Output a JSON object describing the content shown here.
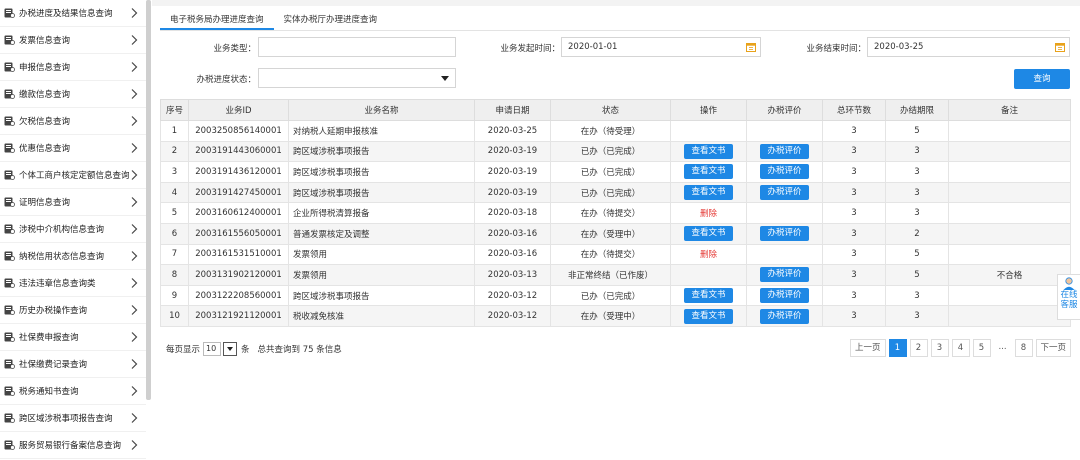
{
  "sidebar": {
    "items": [
      {
        "label": "办税进度及结果信息查询",
        "icon": "progress-search-icon"
      },
      {
        "label": "发票信息查询",
        "icon": "invoice-icon"
      },
      {
        "label": "申报信息查询",
        "icon": "declare-icon"
      },
      {
        "label": "缴款信息查询",
        "icon": "payment-icon"
      },
      {
        "label": "欠税信息查询",
        "icon": "arrears-icon"
      },
      {
        "label": "优惠信息查询",
        "icon": "discount-icon"
      },
      {
        "label": "个体工商户核定定额信息查询",
        "icon": "business-icon"
      },
      {
        "label": "证明信息查询",
        "icon": "certificate-icon"
      },
      {
        "label": "涉税中介机构信息查询",
        "icon": "agency-icon"
      },
      {
        "label": "纳税信用状态信息查询",
        "icon": "credit-icon"
      },
      {
        "label": "违法违章信息查询类",
        "icon": "violation-icon"
      },
      {
        "label": "历史办税操作查询",
        "icon": "history-icon"
      },
      {
        "label": "社保费申报查询",
        "icon": "social-security-icon"
      },
      {
        "label": "社保缴费记录查询",
        "icon": "social-record-icon"
      },
      {
        "label": "税务通知书查询",
        "icon": "notice-icon"
      },
      {
        "label": "跨区域涉税事项报告查询",
        "icon": "cross-region-icon"
      },
      {
        "label": "服务贸易银行备案信息查询",
        "icon": "trade-icon"
      }
    ]
  },
  "tabs": [
    {
      "label": "电子税务局办理进度查询"
    },
    {
      "label": "实体办税厅办理进度查询"
    }
  ],
  "filters": {
    "business_type_label": "业务类型：",
    "business_type_value": "",
    "start_time_label": "业务发起时间：",
    "start_time_value": "2020-01-01",
    "end_time_label": "业务结束时间：",
    "end_time_value": "2020-03-25",
    "status_label": "办税进度状态：",
    "status_value": "",
    "query_button": "查询"
  },
  "table": {
    "headers": [
      "序号",
      "业务ID",
      "业务名称",
      "申请日期",
      "状态",
      "操作",
      "办税评价",
      "总环节数",
      "办结期限",
      "备注"
    ],
    "rows": [
      {
        "no": "1",
        "id": "2003250856140001",
        "name": "对纳税人延期申报核准",
        "date": "2020-03-25",
        "status": "在办（待受理）",
        "status_color": "blue",
        "action": "",
        "rating": "",
        "steps": "3",
        "deadline": "5",
        "note": ""
      },
      {
        "no": "2",
        "id": "2003191443060001",
        "name": "跨区域涉税事项报告",
        "date": "2020-03-19",
        "status": "已办（已完成）",
        "status_color": "green",
        "action": "查看文书",
        "rating": "办税评价",
        "steps": "3",
        "deadline": "3",
        "note": ""
      },
      {
        "no": "3",
        "id": "2003191436120001",
        "name": "跨区域涉税事项报告",
        "date": "2020-03-19",
        "status": "已办（已完成）",
        "status_color": "green",
        "action": "查看文书",
        "rating": "办税评价",
        "steps": "3",
        "deadline": "3",
        "note": ""
      },
      {
        "no": "4",
        "id": "2003191427450001",
        "name": "跨区域涉税事项报告",
        "date": "2020-03-19",
        "status": "已办（已完成）",
        "status_color": "green",
        "action": "查看文书",
        "rating": "办税评价",
        "steps": "3",
        "deadline": "3",
        "note": ""
      },
      {
        "no": "5",
        "id": "2003160612400001",
        "name": "企业所得税清算报备",
        "date": "2020-03-18",
        "status": "在办（待提交）",
        "status_color": "blue",
        "action": "删除",
        "rating": "",
        "steps": "3",
        "deadline": "3",
        "note": ""
      },
      {
        "no": "6",
        "id": "2003161556050001",
        "name": "普通发票核定及调整",
        "date": "2020-03-16",
        "status": "在办（受理中）",
        "status_color": "blue",
        "action": "查看文书",
        "rating": "办税评价",
        "steps": "3",
        "deadline": "2",
        "note": ""
      },
      {
        "no": "7",
        "id": "2003161531510001",
        "name": "发票领用",
        "date": "2020-03-16",
        "status": "在办（待提交）",
        "status_color": "blue",
        "action": "删除",
        "rating": "",
        "steps": "3",
        "deadline": "5",
        "note": ""
      },
      {
        "no": "8",
        "id": "2003131902120001",
        "name": "发票领用",
        "date": "2020-03-13",
        "status": "非正常终结（已作废）",
        "status_color": "blue",
        "action": "",
        "rating": "办税评价",
        "steps": "3",
        "deadline": "5",
        "note": "不合格"
      },
      {
        "no": "9",
        "id": "2003122208560001",
        "name": "跨区域涉税事项报告",
        "date": "2020-03-12",
        "status": "已办（已完成）",
        "status_color": "green",
        "action": "查看文书",
        "rating": "办税评价",
        "steps": "3",
        "deadline": "3",
        "note": ""
      },
      {
        "no": "10",
        "id": "2003121921120001",
        "name": "税收减免核准",
        "date": "2020-03-12",
        "status": "在办（受理中）",
        "status_color": "blue",
        "action": "查看文书",
        "rating": "办税评价",
        "steps": "3",
        "deadline": "3",
        "note": ""
      }
    ]
  },
  "pager": {
    "per_page_prefix": "每页显示",
    "per_page_value": "10",
    "per_page_suffix": "条",
    "total_text": "总共查询到 75 条信息",
    "prev": "上一页",
    "pages": [
      "1",
      "2",
      "3",
      "4",
      "5",
      "...",
      "8"
    ],
    "current": "1",
    "next": "下一页"
  },
  "online_service": {
    "line1": "在线",
    "line2": "客服"
  },
  "colors": {
    "accent": "#1e88e5",
    "done": "#3aa63a",
    "danger": "#e53935"
  }
}
